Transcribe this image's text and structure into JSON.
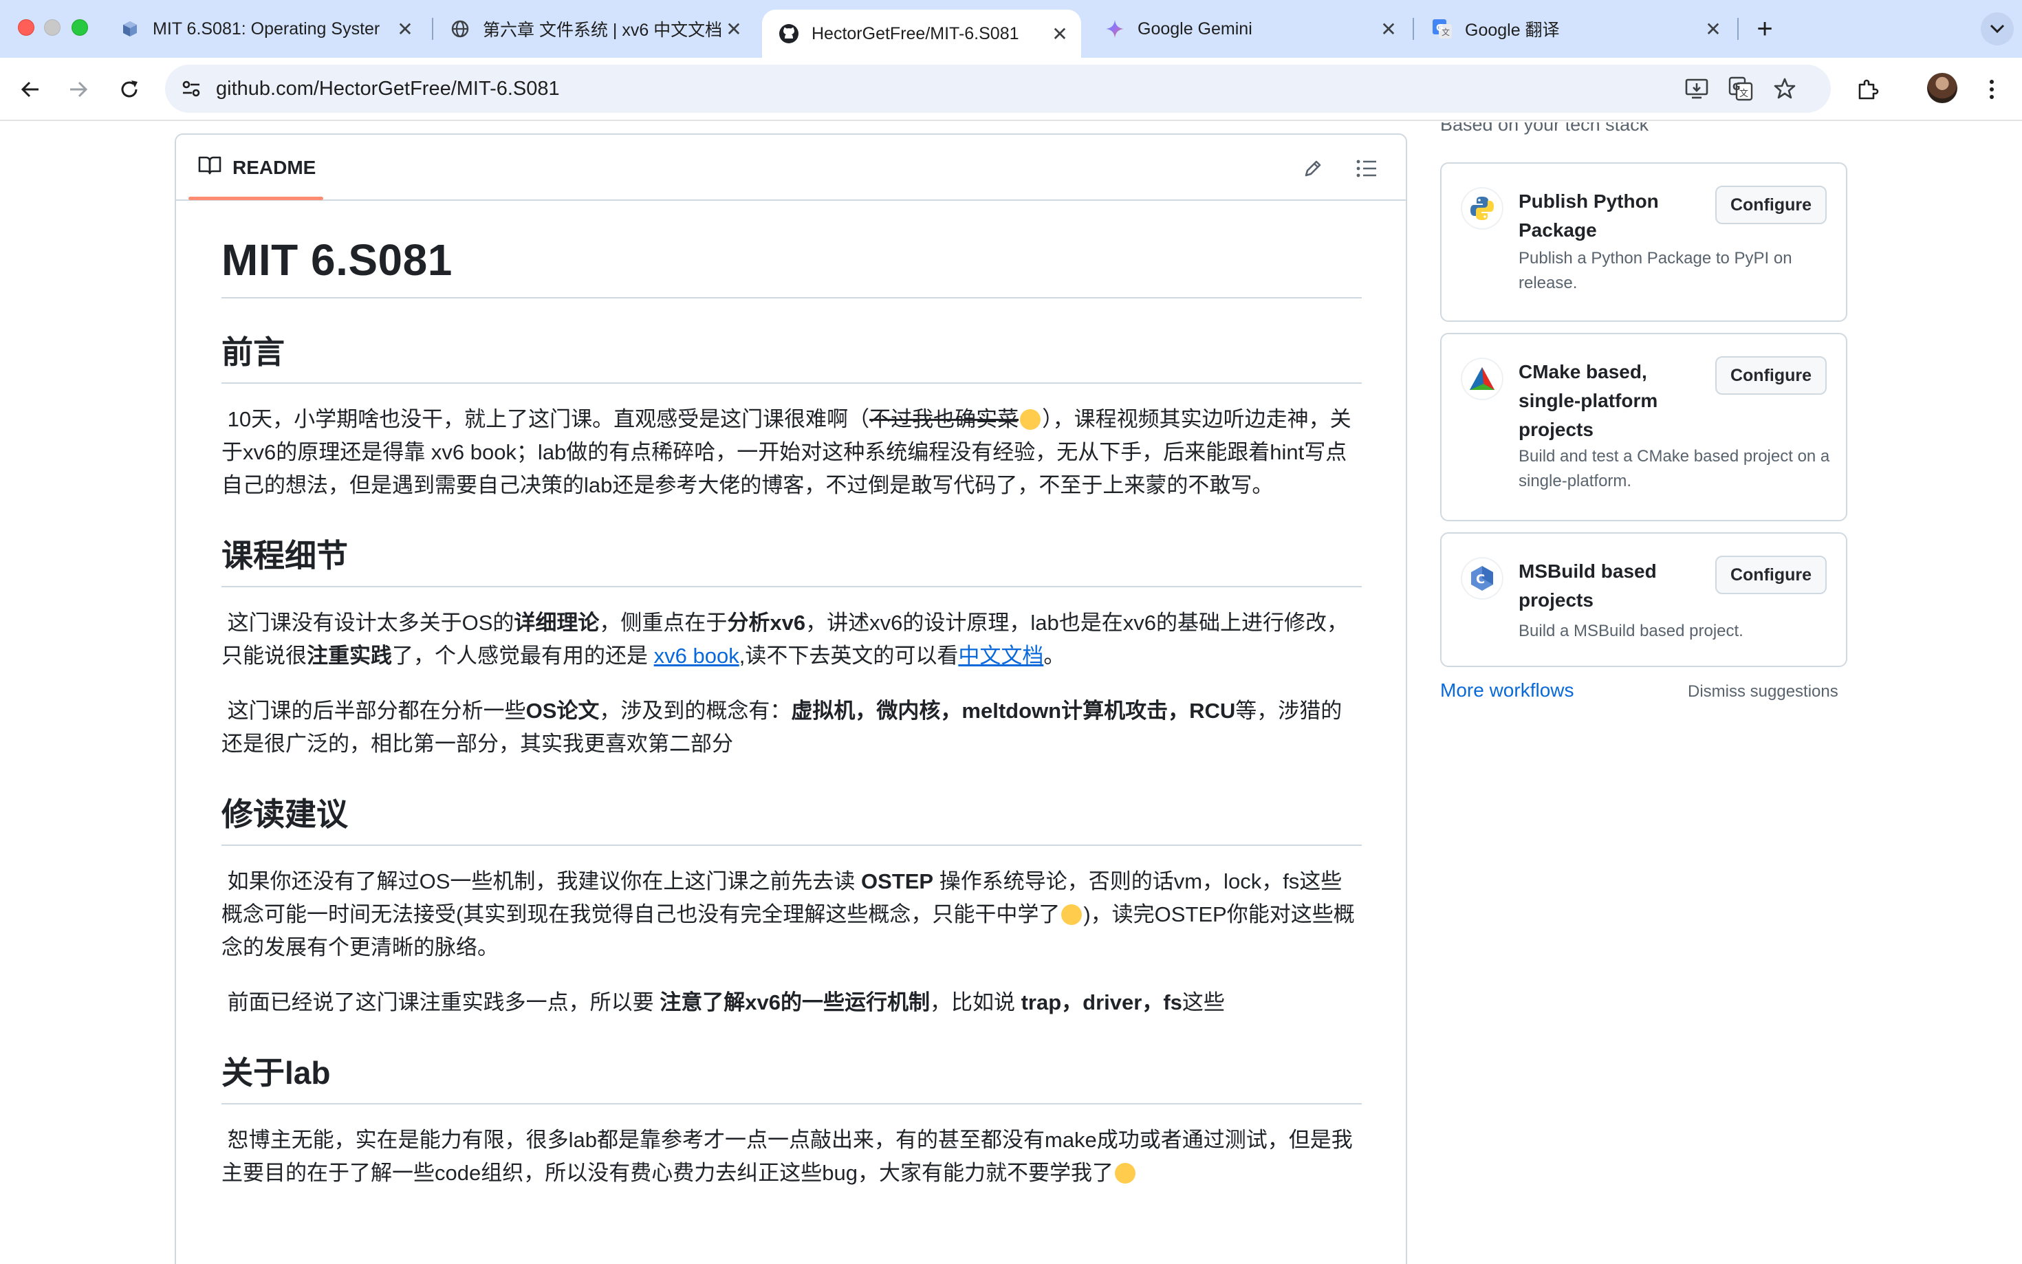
{
  "browser": {
    "tabs": [
      {
        "title": "MIT 6.S081: Operating Syster",
        "favicon": "cube-icon"
      },
      {
        "title": "第六章 文件系统 | xv6 中文文档",
        "favicon": "globe-icon"
      },
      {
        "title": "HectorGetFree/MIT-6.S081",
        "favicon": "github-icon"
      },
      {
        "title": "Google Gemini",
        "favicon": "gemini-icon"
      },
      {
        "title": "Google 翻译",
        "favicon": "google-translate-icon"
      }
    ],
    "url": "github.com/HectorGetFree/MIT-6.S081"
  },
  "readme": {
    "tab_label": "README",
    "h1": "MIT 6.S081",
    "sec1": {
      "title": "前言",
      "p1": {
        "a": "10天，小学期啥也没干，就上了这门课。直观感受是这门课很难啊（",
        "strike": "不过我也确实菜",
        "b": "），课程视频其实边听边走神，关于xv6的原理还是得靠 xv6 book；lab做的有点稀碎哈，一开始对这种系统编程没有经验，无从下手，后来能跟着hint写点自己的想法，但是遇到需要自己决策的lab还是参考大佬的博客，不过倒是敢写代码了，不至于上来蒙的不敢写。"
      }
    },
    "sec2": {
      "title": "课程细节",
      "p1": {
        "t1": "这门课没有设计太多关于OS的",
        "b1": "详细理论",
        "t2": "，侧重点在于",
        "b2": "分析xv6",
        "t3": "，讲述xv6的设计原理，lab也是在xv6的基础上进行修改，只能说很",
        "b3": "注重实践",
        "t4": "了，个人感觉最有用的还是 ",
        "link1": "xv6 book",
        "t5": ",读不下去英文的可以看",
        "link2": "中文文档",
        "t6": "。"
      },
      "p2": {
        "t1": "这门课的后半部分都在分析一些",
        "b1": "OS论文",
        "t2": "，涉及到的概念有：",
        "b2": "虚拟机，微内核，meltdown计算机攻击，RCU",
        "t3": "等，涉猎的还是很广泛的，相比第一部分，其实我更喜欢第二部分"
      }
    },
    "sec3": {
      "title": "修读建议",
      "p1": {
        "t1": "如果你还没有了解过OS一些机制，我建议你在上这门课之前先去读 ",
        "b1": "OSTEP",
        "t2": " 操作系统导论，否则的话vm，lock，fs这些概念可能一时间无法接受(其实到现在我觉得自己也没有完全理解这些概念，只能干中学了",
        "t3": ")，读完OSTEP你能对这些概念的发展有个更清晰的脉络。"
      },
      "p2": {
        "t1": "前面已经说了这门课注重实践多一点，所以要 ",
        "b1": "注意了解xv6的一些运行机制",
        "t2": "，比如说 ",
        "b2": "trap，driver，fs",
        "t3": "这些"
      }
    },
    "sec4": {
      "title": "关于lab",
      "p1": "恕博主无能，实在是能力有限，很多lab都是靠参考才一点一点敲出来，有的甚至都没有make成功或者通过测试，但是我主要目的在于了解一些code组织，所以没有费心费力去纠正这些bug，大家有能力就不要学我了"
    }
  },
  "sidebar": {
    "section_label": "Based on your tech stack",
    "workflows": [
      {
        "title": "Publish Python Package",
        "desc": "Publish a Python Package to PyPI on release.",
        "button": "Configure",
        "icon": "python-icon"
      },
      {
        "title": "CMake based, single-platform projects",
        "desc": "Build and test a CMake based project on a single-platform.",
        "button": "Configure",
        "icon": "cmake-icon"
      },
      {
        "title": "MSBuild based projects",
        "desc": "Build a MSBuild based project.",
        "button": "Configure",
        "icon": "msbuild-icon"
      }
    ],
    "more_workflows": "More workflows",
    "dismiss": "Dismiss suggestions"
  }
}
